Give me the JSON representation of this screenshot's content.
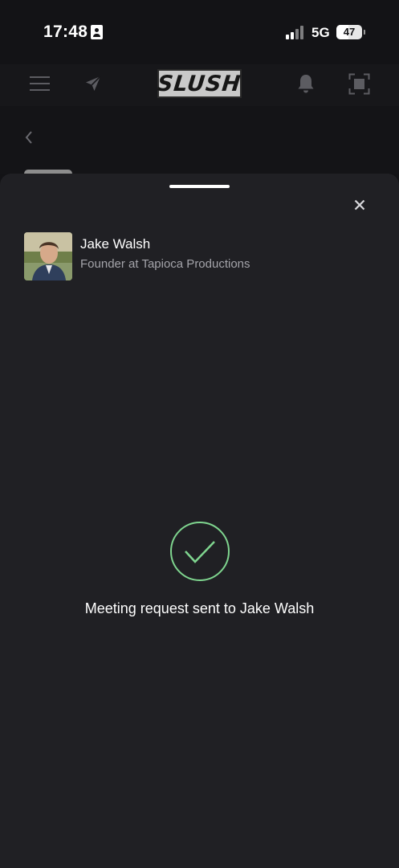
{
  "status_bar": {
    "time": "17:48",
    "network": "5G",
    "battery_percent": "47",
    "id_icon": "contact-card-icon",
    "signal_icon": "signal-bars-icon"
  },
  "header": {
    "logo_text": "SLUSH",
    "icons": {
      "menu": "menu-icon",
      "send": "send-icon",
      "notifications": "bell-icon",
      "scan": "qr-scan-icon"
    }
  },
  "sub_header": {
    "back_icon": "chevron-left-icon"
  },
  "sheet": {
    "close_icon": "close-icon",
    "profile": {
      "name": "Jake Walsh",
      "title": "Founder at Tapioca Productions"
    },
    "success": {
      "icon": "check-circle-icon",
      "message": "Meeting request sent to Jake Walsh",
      "accent": "#7fd58f"
    }
  },
  "colors": {
    "background": "#131316",
    "header_bg": "#17171a",
    "sheet_bg": "#202024",
    "muted_text": "#a4a4aa",
    "icon_gray": "#5c5c61",
    "success_green": "#7fd58f"
  }
}
